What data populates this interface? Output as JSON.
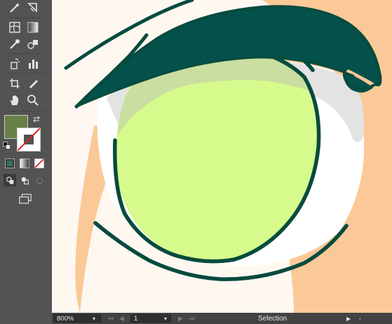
{
  "toolbar": {
    "tools": [
      {
        "name": "magic-wand",
        "glyph": "✧"
      },
      {
        "name": "lasso",
        "glyph": "◌"
      },
      {
        "name": "mesh",
        "glyph": "#"
      },
      {
        "name": "gradient",
        "glyph": "▤"
      },
      {
        "name": "eyedropper",
        "glyph": "✎"
      },
      {
        "name": "blend",
        "glyph": "◎"
      },
      {
        "name": "symbol-sprayer",
        "glyph": "✺"
      },
      {
        "name": "column-graph",
        "glyph": "▥"
      },
      {
        "name": "artboard",
        "glyph": "⊡"
      },
      {
        "name": "slice",
        "glyph": "✐"
      },
      {
        "name": "hand",
        "glyph": "✋"
      },
      {
        "name": "zoom",
        "glyph": "⌕"
      }
    ],
    "fill_color": "#687f45",
    "stroke_color": "#ffffff"
  },
  "colors": {
    "iris": "#d6fb8c",
    "iris_shade": "#c9dea0",
    "stroke_dark": "#074b3e",
    "lid": "#04504b",
    "skin": "#fbc997",
    "highlight": "#fff8f1",
    "sclera": "#ffffff",
    "sclera_shadow": "#e3e3e3"
  },
  "status": {
    "zoom": "800%",
    "artboard": "1",
    "tool_label": "Selection"
  }
}
